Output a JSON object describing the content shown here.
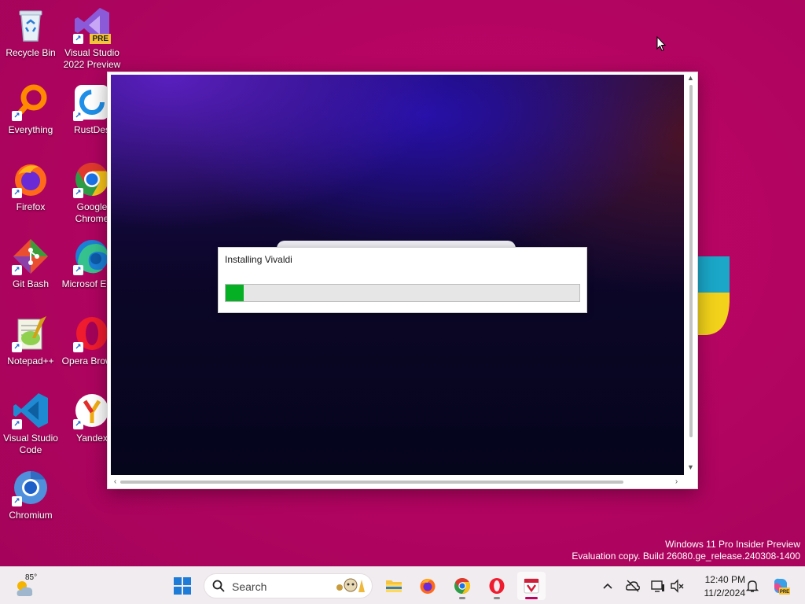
{
  "desktop": {
    "icons": [
      {
        "label": "Recycle Bin"
      },
      {
        "label": "Visual Studio 2022 Preview",
        "badge": "PRE"
      },
      {
        "label": "Everything"
      },
      {
        "label": "RustDes"
      },
      {
        "label": "Firefox"
      },
      {
        "label": "Google Chrome"
      },
      {
        "label": "Git Bash"
      },
      {
        "label": "Microsof Edge"
      },
      {
        "label": "Notepad++"
      },
      {
        "label": "Opera Browse"
      },
      {
        "label": "Visual Studio Code"
      },
      {
        "label": "Yandex"
      },
      {
        "label": "Chromium"
      }
    ]
  },
  "installer": {
    "dialog_title": "Installing Vivaldi",
    "progress_fraction": 0.05
  },
  "watermark": {
    "line1": "Windows 11 Pro Insider Preview",
    "line2": "Evaluation copy. Build 26080.ge_release.240308-1400"
  },
  "taskbar": {
    "weather_temp": "85°",
    "search_placeholder": "Search",
    "apps": [
      "start",
      "file-explorer",
      "firefox",
      "chrome",
      "opera",
      "vivaldi"
    ],
    "active_app": "vivaldi",
    "clock_time": "12:40 PM",
    "clock_date": "11/2/2024"
  },
  "colors": {
    "desktop": "#b5045f",
    "progress_fill": "#06b025",
    "accent": "#c1005f"
  }
}
